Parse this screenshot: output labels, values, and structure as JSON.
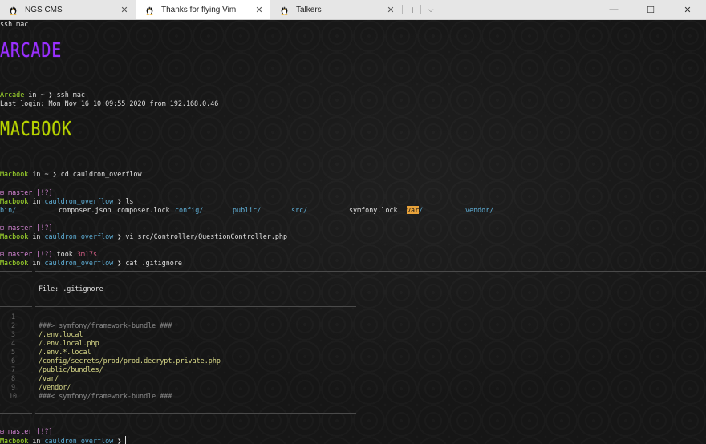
{
  "tabs": [
    {
      "title": "NGS CMS"
    },
    {
      "title": "Thanks for flying Vim"
    },
    {
      "title": "Talkers"
    }
  ],
  "window": {
    "new_tab": "+",
    "dropdown": "⌵",
    "minimize": "—",
    "maximize": "☐",
    "close": "✕",
    "tab_close": "✕"
  },
  "terminal": {
    "line_ssh": "ssh mac",
    "banner_arcade": "ARCADE",
    "banner_macbook": "MACBOOK",
    "arcade_host": "Arcade",
    "in": " in ",
    "home": "~",
    "arrow": " ❯ ",
    "cmd_ssh": "ssh mac",
    "last_login": "Last login: Mon Nov 16 10:09:55 2020 from 192.168.0.46",
    "mac_host": "Macbook",
    "cmd_cd": "cd cauldron_overflow",
    "branch": "⊟ master [!?]",
    "project": "cauldron_overflow",
    "cmd_ls": "ls",
    "ls": {
      "bin": "bin/",
      "composer_json": "composer.json",
      "composer_lock": "composer.lock",
      "config": "config/",
      "public": "public/",
      "src": "src/",
      "symfony_lock": "symfony.lock",
      "var": "var",
      "var_slash": "/",
      "vendor": "vendor/"
    },
    "cmd_vi": "vi src/Controller/QuestionController.php",
    "took": "took ",
    "took_time": "3m17s",
    "cmd_cat": "cat .gitignore",
    "bat_file": "File: .gitignore",
    "bat_lines": [
      {
        "n": "1",
        "text": ""
      },
      {
        "n": "2",
        "text": "###> symfony/framework-bundle ###"
      },
      {
        "n": "3",
        "text": "/.env.local"
      },
      {
        "n": "4",
        "text": "/.env.local.php"
      },
      {
        "n": "5",
        "text": "/.env.*.local"
      },
      {
        "n": "6",
        "text": "/config/secrets/prod/prod.decrypt.private.php"
      },
      {
        "n": "7",
        "text": "/public/bundles/"
      },
      {
        "n": "8",
        "text": "/var/"
      },
      {
        "n": "9",
        "text": "/vendor/"
      },
      {
        "n": "10",
        "text": "###< symfony/framework-bundle ###"
      }
    ]
  },
  "colors": {
    "arcade": "#9b30ff",
    "macbook": "#b8d400",
    "host": "#a6e22e",
    "dir": "#5fafd7",
    "git": "#d787d7",
    "highlight": "#e8a23a"
  }
}
